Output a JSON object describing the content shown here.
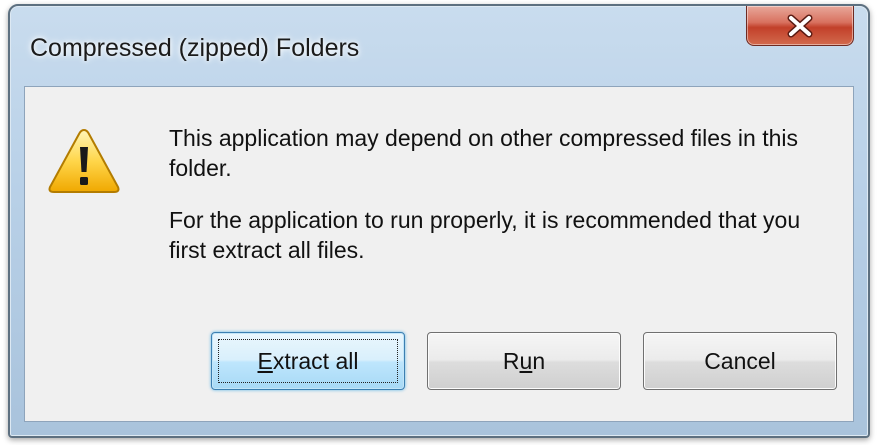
{
  "window": {
    "title": "Compressed (zipped) Folders",
    "close_icon": "close-x-icon"
  },
  "icon": {
    "name": "warning-icon",
    "colors": {
      "fill_top": "#fff3a6",
      "fill_bottom": "#f2b100",
      "border": "#b07a00",
      "mark": "#1a1a1a"
    }
  },
  "message": {
    "line1": "This application may depend on other compressed files in this folder.",
    "line2": "For the application to run properly, it is recommended that you first extract all files."
  },
  "buttons": {
    "extract": {
      "mnemonic": "E",
      "rest": "xtract all"
    },
    "run": {
      "pre": "R",
      "mnemonic": "u",
      "rest": "n"
    },
    "cancel": "Cancel"
  },
  "colors": {
    "close_button": "#c2402a",
    "default_button_border": "#3c7fb1",
    "dialog_body": "#f0f0f0"
  }
}
